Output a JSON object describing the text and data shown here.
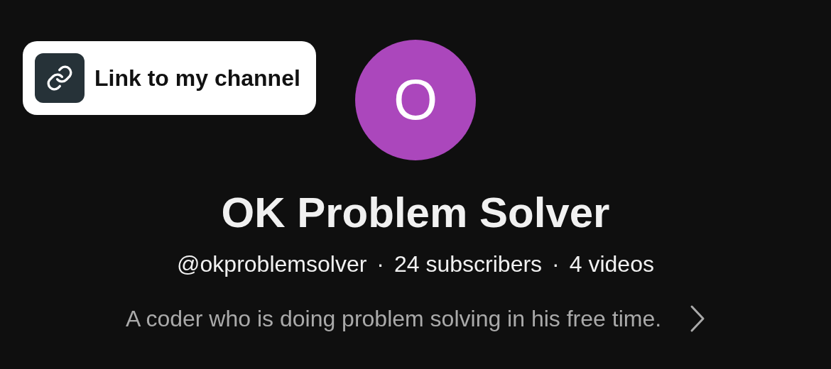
{
  "link_chip": {
    "label": "Link to my channel"
  },
  "channel": {
    "avatar_letter": "O",
    "name": "OK Problem Solver",
    "handle": "@okproblemsolver",
    "separator": "·",
    "subscribers": "24 subscribers",
    "videos": "4 videos",
    "description": "A coder who is doing problem solving in his free time."
  }
}
